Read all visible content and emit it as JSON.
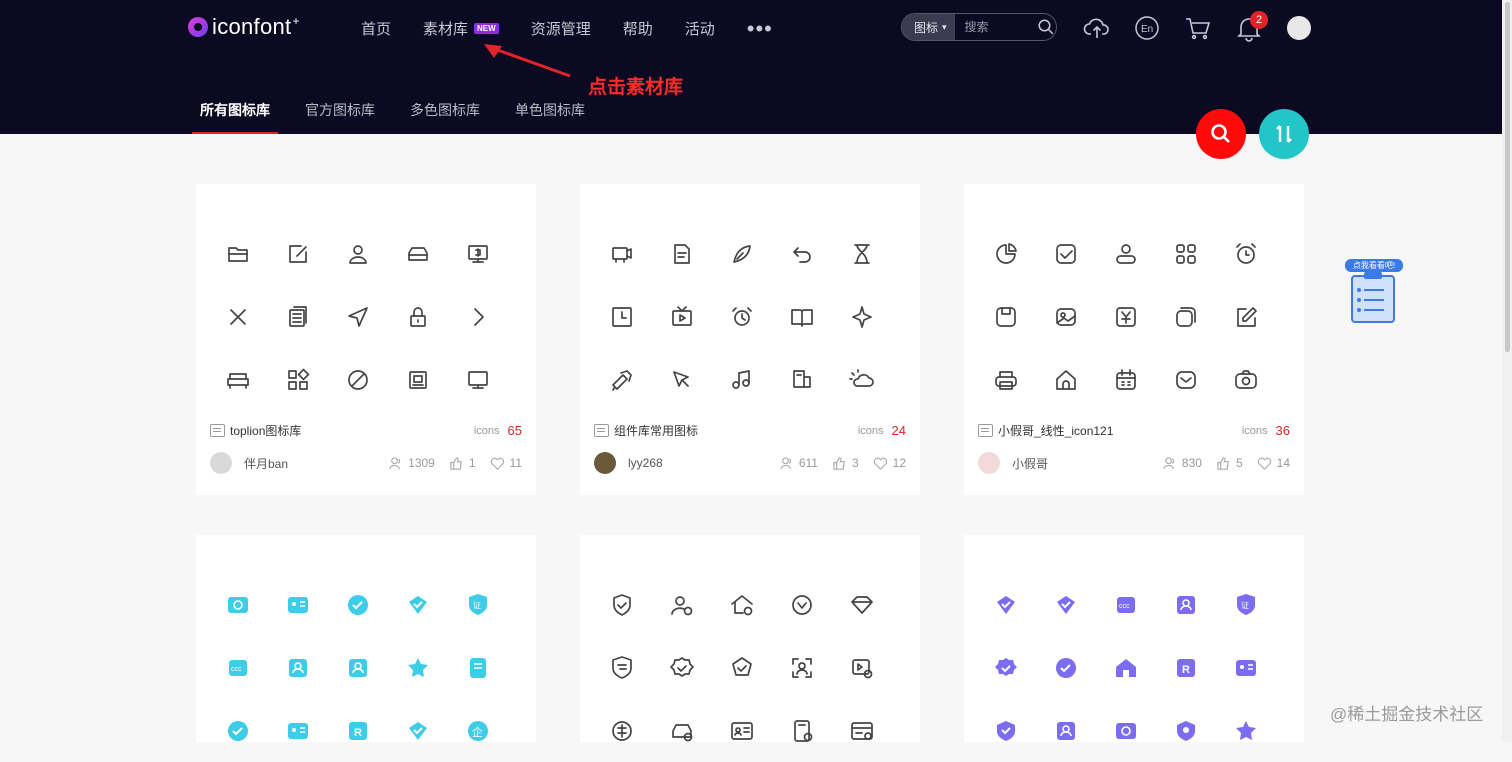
{
  "header": {
    "logo_text": "iconfont",
    "logo_plus": "+",
    "nav": [
      {
        "label": "首页"
      },
      {
        "label": "素材库",
        "badge": "NEW"
      },
      {
        "label": "资源管理"
      },
      {
        "label": "帮助"
      },
      {
        "label": "活动"
      }
    ],
    "more_label": "•••",
    "search": {
      "type_label": "图标",
      "placeholder": "搜索"
    },
    "notification_count": "2",
    "icons": [
      "upload-cloud-icon",
      "language-en-icon",
      "cart-icon",
      "bell-icon"
    ]
  },
  "subnav": [
    {
      "label": "所有图标库",
      "active": true
    },
    {
      "label": "官方图标库"
    },
    {
      "label": "多色图标库"
    },
    {
      "label": "单色图标库"
    }
  ],
  "annotation": {
    "text": "点击素材库",
    "color": "#ff2a2a"
  },
  "fabs": {
    "search": "search-icon",
    "sort": "sort-icon"
  },
  "cards": [
    {
      "title": "toplion图标库",
      "icons_label": "icons",
      "count": "65",
      "author": "伴月ban",
      "stats": [
        "1309",
        "1",
        "11"
      ],
      "style": "mono"
    },
    {
      "title": "组件库常用图标",
      "icons_label": "icons",
      "count": "24",
      "author": "lyy268",
      "stats": [
        "611",
        "3",
        "12"
      ],
      "style": "mono"
    },
    {
      "title": "小假哥_线性_icon121",
      "icons_label": "icons",
      "count": "36",
      "author": "小假哥",
      "stats": [
        "830",
        "5",
        "14"
      ],
      "style": "mono"
    },
    {
      "style": "cyan"
    },
    {
      "style": "mono"
    },
    {
      "style": "purple"
    }
  ],
  "side_widget": {
    "label": "点我看看吧!"
  },
  "watermark": "@稀土掘金技术社区",
  "colors": {
    "header_bg": "#0b0a22",
    "accent_red": "#e0242a",
    "fab_red": "#ff0a0a",
    "fab_teal": "#22c6c9",
    "icon_cyan": "#3ecde8",
    "icon_purple": "#7b6cf0"
  }
}
